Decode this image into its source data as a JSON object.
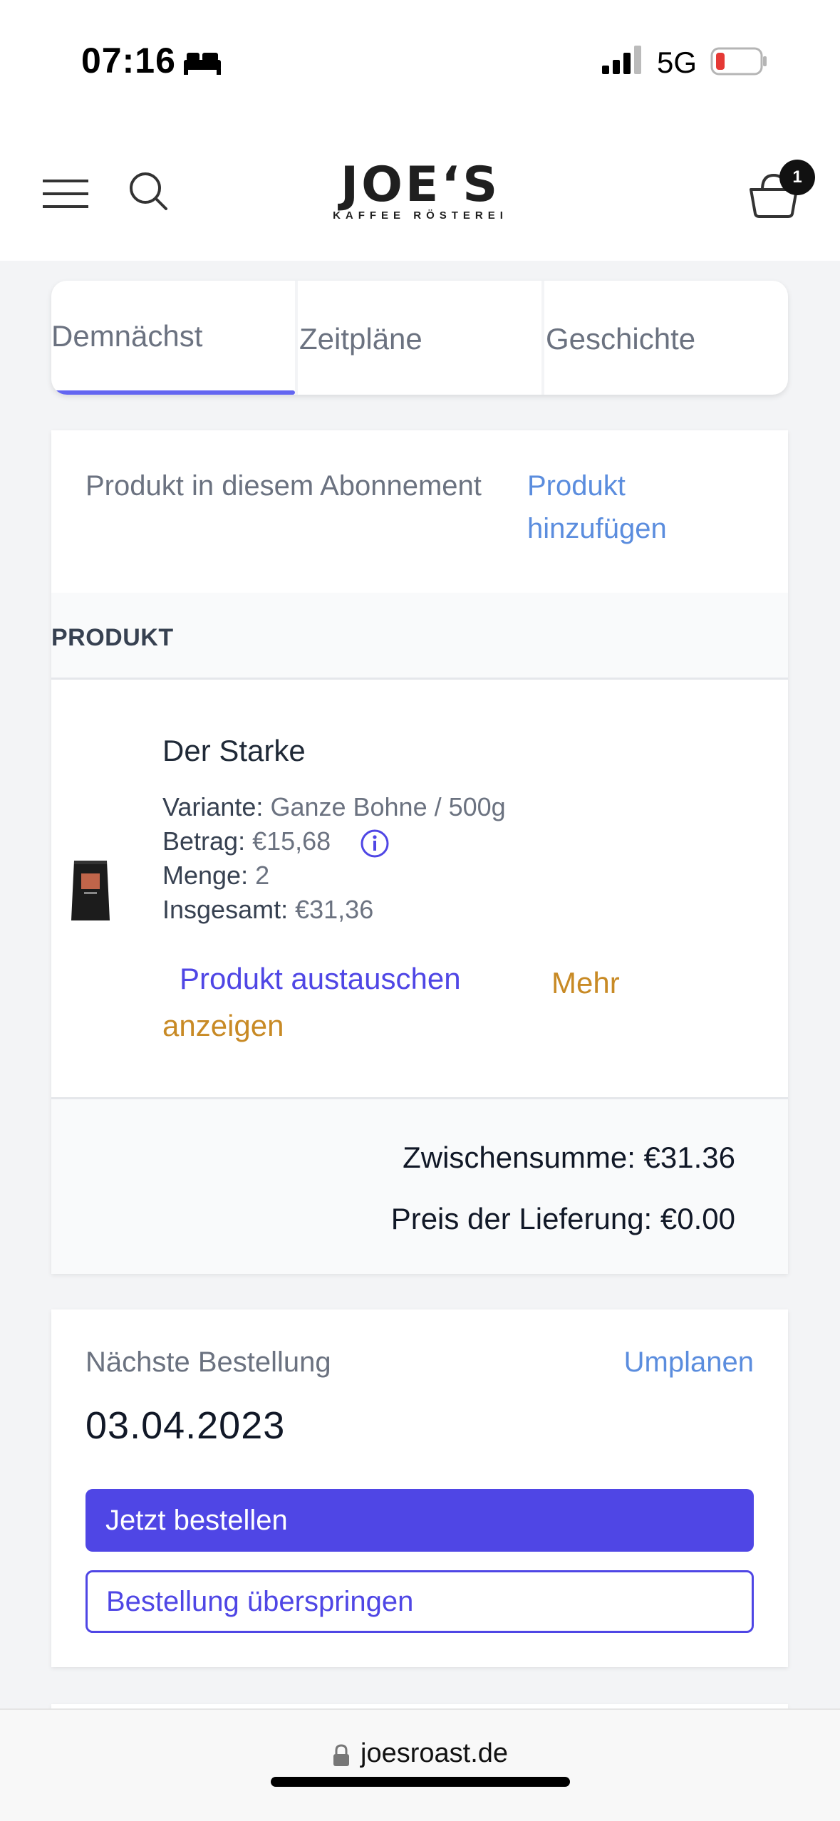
{
  "status_bar": {
    "time": "07:16",
    "network": "5G"
  },
  "header": {
    "logo_main": "JOE‘S",
    "logo_sub": "KAFFEE RÖSTEREI",
    "cart_count": "1"
  },
  "tabs": [
    {
      "label": "Demnächst",
      "active": true
    },
    {
      "label": "Zeitpläne",
      "active": false
    },
    {
      "label": "Geschichte",
      "active": false
    }
  ],
  "subscription": {
    "heading": "Produkt in diesem Abonnement",
    "add_product": "Produkt hinzufügen",
    "column_header": "PRODUKT",
    "product": {
      "name": "Der Starke",
      "variant_label": "Variante:",
      "variant_value": "Ganze Bohne / 500g",
      "amount_label": "Betrag:",
      "amount_value": "€15,68",
      "quantity_label": "Menge:",
      "quantity_value": "2",
      "total_label": "Insgesamt:",
      "total_value": "€31,36",
      "swap_link": "Produkt austauschen",
      "more_link": "Mehr anzeigen"
    },
    "subtotal": "Zwischensumme: €31.36",
    "delivery_price": "Preis der Lieferung: €0.00"
  },
  "next_order": {
    "label": "Nächste Bestellung",
    "replan": "Umplanen",
    "date": "03.04.2023",
    "order_now": "Jetzt bestellen",
    "skip": "Bestellung überspringen"
  },
  "browser": {
    "url": "joesroast.de"
  },
  "colors": {
    "accent": "#4f46e5",
    "link": "#5b8dde",
    "more_link": "#c88a25",
    "tab_indicator": "#6366f1"
  }
}
